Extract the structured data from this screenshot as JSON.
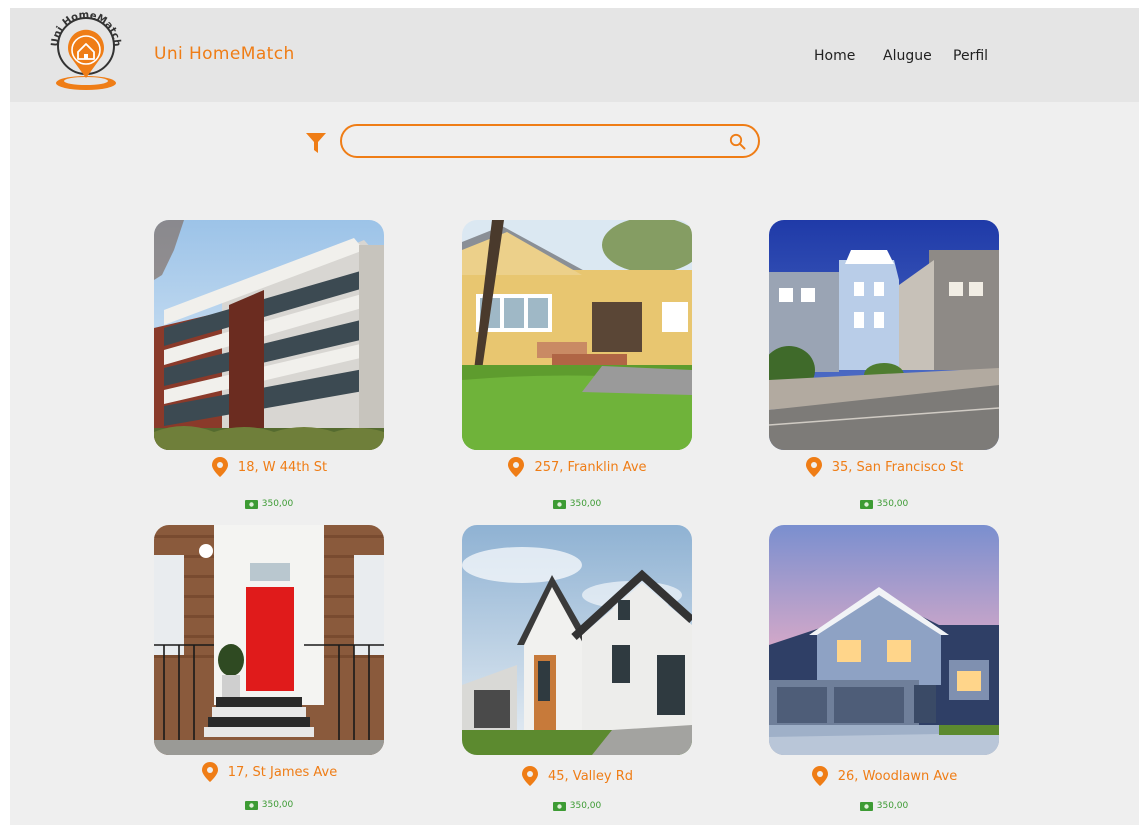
{
  "brand": {
    "name": "Uni HomeMatch",
    "logo_text": "Uni HomeMatch",
    "accent_color": "#ef7d16"
  },
  "nav": {
    "items": [
      {
        "label": "Home"
      },
      {
        "label": "Alugue"
      },
      {
        "label": "Perfil"
      }
    ]
  },
  "search": {
    "value": "",
    "placeholder": "",
    "filter_icon": "filter-icon",
    "search_icon": "search-icon"
  },
  "listings": [
    {
      "address": "18, W 44th St",
      "price": "350,00",
      "photo": "modern-apartment-building"
    },
    {
      "address": "257, Franklin Ave",
      "price": "350,00",
      "photo": "yellow-house"
    },
    {
      "address": "35, San Francisco St",
      "price": "350,00",
      "photo": "victorian-houses"
    },
    {
      "address": "17, St James Ave",
      "price": "350,00",
      "photo": "red-door-townhouse"
    },
    {
      "address": "45, Valley Rd",
      "price": "350,00",
      "photo": "modern-white-house"
    },
    {
      "address": "26, Woodlawn Ave",
      "price": "350,00",
      "photo": "blue-suburban-house"
    }
  ],
  "colors": {
    "price_green": "#3d9b34",
    "background": "#efefef",
    "navbar": "#e5e5e5"
  }
}
